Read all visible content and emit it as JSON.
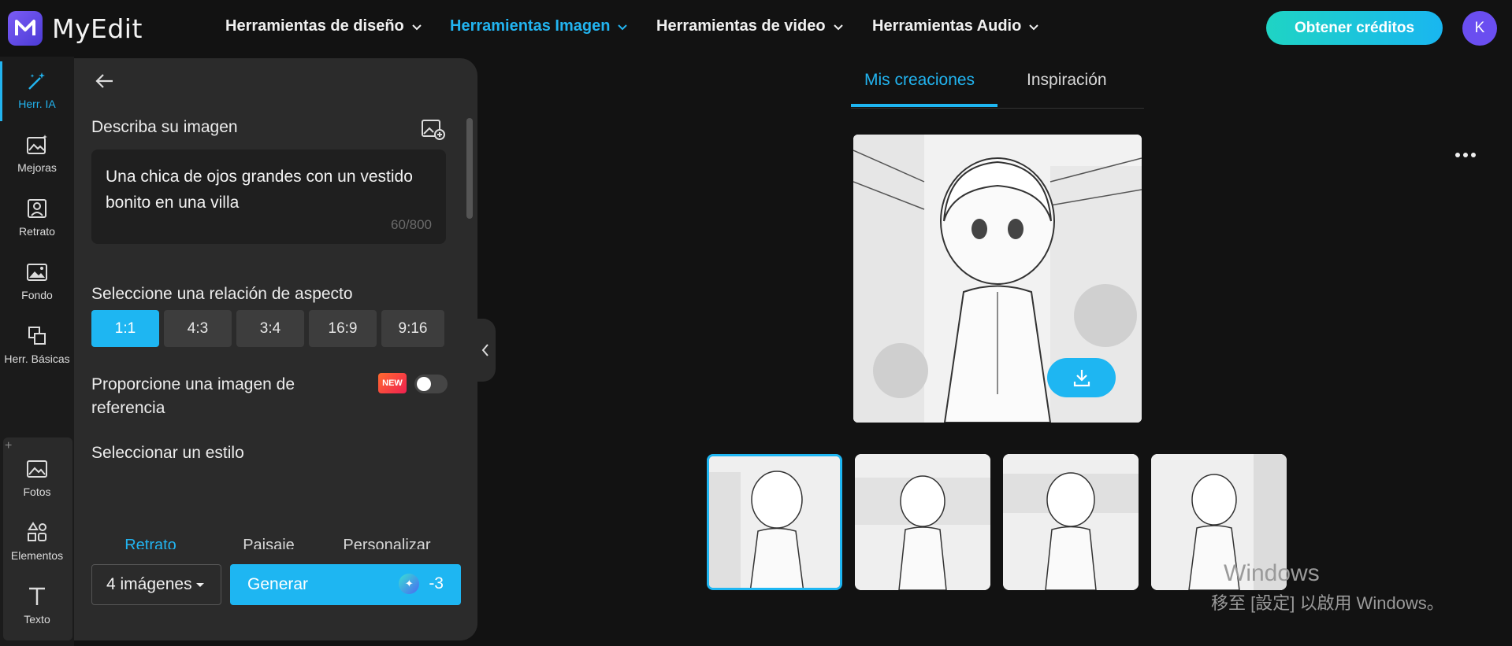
{
  "app": {
    "name": "MyEdit",
    "avatar_letter": "K"
  },
  "nav": [
    {
      "label": "Herramientas de diseño",
      "active": false
    },
    {
      "label": "Herramientas Imagen",
      "active": true
    },
    {
      "label": "Herramientas de video",
      "active": false
    },
    {
      "label": "Herramientas Audio",
      "active": false
    }
  ],
  "cta_label": "Obtener créditos",
  "rail": [
    {
      "label": "Herr. IA",
      "icon": "magic-wand-icon",
      "active": true
    },
    {
      "label": "Mejoras",
      "icon": "enhance-icon"
    },
    {
      "label": "Retrato",
      "icon": "portrait-icon"
    },
    {
      "label": "Fondo",
      "icon": "background-icon"
    },
    {
      "label": "Herr. Básicas",
      "icon": "basic-tools-icon"
    },
    {
      "label": "Fotos",
      "icon": "photos-icon"
    },
    {
      "label": "Elementos",
      "icon": "elements-icon"
    },
    {
      "label": "Texto",
      "icon": "text-icon"
    }
  ],
  "panel": {
    "describe_label": "Describa su imagen",
    "prompt_text": "Una chica de ojos grandes con un vestido bonito en una villa",
    "counter": "60/800",
    "aspect_label": "Seleccione una relación de aspecto",
    "ratios": [
      "1:1",
      "4:3",
      "3:4",
      "16:9",
      "9:16"
    ],
    "reference_label": "Proporcione una imagen de referencia",
    "new_badge": "NEW",
    "style_label": "Seleccionar un estilo",
    "style_tabs": [
      "Retrato",
      "Paisaje",
      "Personalizar"
    ],
    "quantity": "4 imágenes",
    "generate_label": "Generar",
    "generate_cost": "-3"
  },
  "main": {
    "tabs": [
      "Mis creaciones",
      "Inspiración"
    ]
  },
  "watermark": {
    "line1": "Windows",
    "line2": "移至 [設定] 以啟用 Windows。"
  }
}
